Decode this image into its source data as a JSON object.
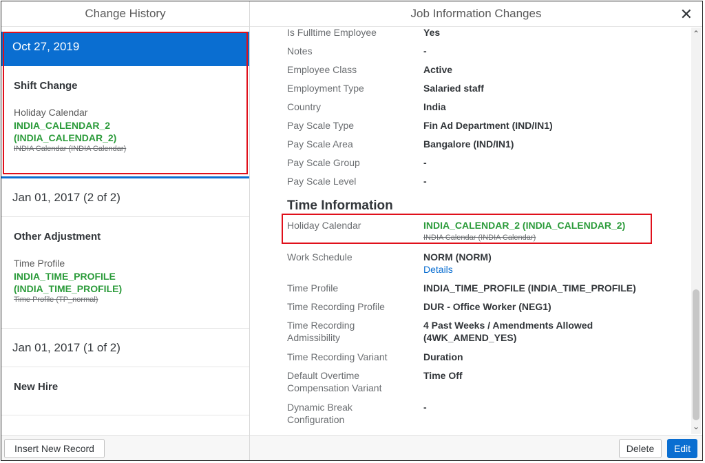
{
  "left_panel": {
    "title": "Change History",
    "selected_date": "Oct 27, 2019",
    "selected_event": {
      "title": "Shift Change",
      "field": "Holiday Calendar",
      "new_value_line1": "INDIA_CALENDAR_2",
      "new_value_line2": "(INDIA_CALENDAR_2)",
      "old_value": "INDIA Calendar (INDIA Calendar)"
    },
    "records": [
      {
        "date": "Jan 01, 2017 (2 of 2)",
        "title": "Other Adjustment",
        "field": "Time Profile",
        "new_value_line1": "INDIA_TIME_PROFILE",
        "new_value_line2": "(INDIA_TIME_PROFILE)",
        "old_value": "Time Profile (TP_normal)"
      },
      {
        "date": "Jan 01, 2017 (1 of 2)",
        "title": "New Hire"
      }
    ],
    "insert_button": "Insert New Record"
  },
  "right_panel": {
    "title": "Job Information Changes",
    "close_icon": "close-icon",
    "rows_top": [
      {
        "label": "Is Fulltime Employee",
        "value": "Yes"
      },
      {
        "label": "Notes",
        "value": "-"
      },
      {
        "label": "Employee Class",
        "value": "Active"
      },
      {
        "label": "Employment Type",
        "value": "Salaried staff"
      },
      {
        "label": "Country",
        "value": "India"
      },
      {
        "label": "Pay Scale Type",
        "value": "Fin Ad Department (IND/IN1)"
      },
      {
        "label": "Pay Scale Area",
        "value": "Bangalore (IND/IN1)"
      },
      {
        "label": "Pay Scale Group",
        "value": "-"
      },
      {
        "label": "Pay Scale Level",
        "value": "-"
      }
    ],
    "section_title": "Time Information",
    "holiday": {
      "label": "Holiday Calendar",
      "new_value": "INDIA_CALENDAR_2 (INDIA_CALENDAR_2)",
      "old_value": "INDIA Calendar (INDIA Calendar)"
    },
    "work_schedule": {
      "label": "Work Schedule",
      "value": "NORM (NORM)",
      "link": "Details"
    },
    "rows_bottom": [
      {
        "label": "Time Profile",
        "value": "INDIA_TIME_PROFILE (INDIA_TIME_PROFILE)"
      },
      {
        "label": "Time Recording Profile",
        "value": "DUR - Office Worker (NEG1)"
      },
      {
        "label_line1": "Time Recording",
        "label_line2": "Admissibility",
        "value_line1": "4 Past Weeks / Amendments Allowed",
        "value_line2": "(4WK_AMEND_YES)"
      },
      {
        "label": "Time Recording Variant",
        "value": "Duration"
      },
      {
        "label_line1": "Default Overtime",
        "label_line2": "Compensation Variant",
        "value": "Time Off"
      },
      {
        "label_line1": "Dynamic Break",
        "label_line2": "Configuration",
        "value": "-"
      }
    ],
    "delete_button": "Delete",
    "edit_button": "Edit",
    "colors": {
      "accent": "#0a6ed1",
      "new_value": "#2b9b3a",
      "highlight": "#e0101b"
    }
  }
}
